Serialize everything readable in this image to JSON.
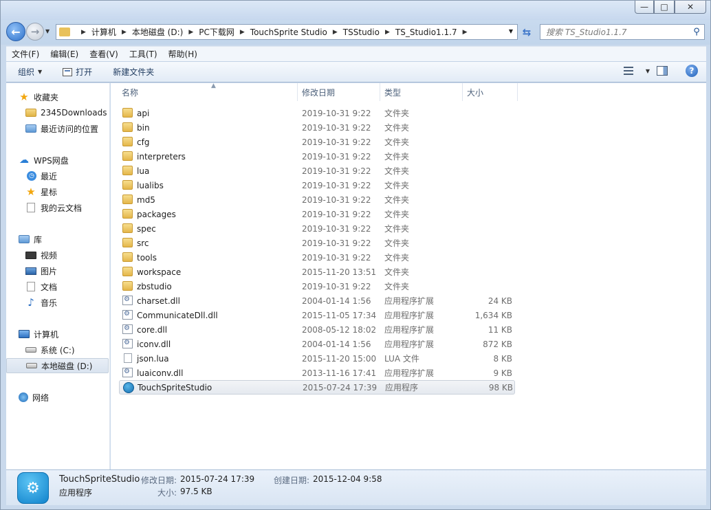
{
  "window": {
    "minimize": "—",
    "maximize": "□",
    "close": "✕"
  },
  "nav": {
    "back": "←",
    "forward": "→",
    "breadcrumbs": [
      "计算机",
      "本地磁盘 (D:)",
      "PC下载网",
      "TouchSprite Studio",
      "TSStudio",
      "TS_Studio1.1.7"
    ],
    "search_placeholder": "搜索 TS_Studio1.1.7"
  },
  "menu": [
    "文件(F)",
    "编辑(E)",
    "查看(V)",
    "工具(T)",
    "帮助(H)"
  ],
  "toolbar": {
    "organize": "组织",
    "open": "打开",
    "new_folder": "新建文件夹"
  },
  "sidebar": {
    "favorites": "收藏夹",
    "fav_items": [
      "2345Downloads",
      "最近访问的位置"
    ],
    "wps": "WPS网盘",
    "wps_items": [
      "最近",
      "星标",
      "我的云文档"
    ],
    "libraries": "库",
    "lib_items": [
      "视频",
      "图片",
      "文档",
      "音乐"
    ],
    "computer": "计算机",
    "computer_items": [
      "系统 (C:)",
      "本地磁盘 (D:)"
    ],
    "network": "网络"
  },
  "columns": {
    "name": "名称",
    "date": "修改日期",
    "type": "类型",
    "size": "大小"
  },
  "files": [
    {
      "name": "api",
      "date": "2019-10-31 9:22",
      "type": "文件夹",
      "size": "",
      "kind": "folder"
    },
    {
      "name": "bin",
      "date": "2019-10-31 9:22",
      "type": "文件夹",
      "size": "",
      "kind": "folder"
    },
    {
      "name": "cfg",
      "date": "2019-10-31 9:22",
      "type": "文件夹",
      "size": "",
      "kind": "folder"
    },
    {
      "name": "interpreters",
      "date": "2019-10-31 9:22",
      "type": "文件夹",
      "size": "",
      "kind": "folder"
    },
    {
      "name": "lua",
      "date": "2019-10-31 9:22",
      "type": "文件夹",
      "size": "",
      "kind": "folder"
    },
    {
      "name": "lualibs",
      "date": "2019-10-31 9:22",
      "type": "文件夹",
      "size": "",
      "kind": "folder"
    },
    {
      "name": "md5",
      "date": "2019-10-31 9:22",
      "type": "文件夹",
      "size": "",
      "kind": "folder"
    },
    {
      "name": "packages",
      "date": "2019-10-31 9:22",
      "type": "文件夹",
      "size": "",
      "kind": "folder"
    },
    {
      "name": "spec",
      "date": "2019-10-31 9:22",
      "type": "文件夹",
      "size": "",
      "kind": "folder"
    },
    {
      "name": "src",
      "date": "2019-10-31 9:22",
      "type": "文件夹",
      "size": "",
      "kind": "folder"
    },
    {
      "name": "tools",
      "date": "2019-10-31 9:22",
      "type": "文件夹",
      "size": "",
      "kind": "folder"
    },
    {
      "name": "workspace",
      "date": "2015-11-20 13:51",
      "type": "文件夹",
      "size": "",
      "kind": "folder"
    },
    {
      "name": "zbstudio",
      "date": "2019-10-31 9:22",
      "type": "文件夹",
      "size": "",
      "kind": "folder"
    },
    {
      "name": "charset.dll",
      "date": "2004-01-14 1:56",
      "type": "应用程序扩展",
      "size": "24 KB",
      "kind": "dll"
    },
    {
      "name": "CommunicateDll.dll",
      "date": "2015-11-05 17:34",
      "type": "应用程序扩展",
      "size": "1,634 KB",
      "kind": "dll"
    },
    {
      "name": "core.dll",
      "date": "2008-05-12 18:02",
      "type": "应用程序扩展",
      "size": "11 KB",
      "kind": "dll"
    },
    {
      "name": "iconv.dll",
      "date": "2004-01-14 1:56",
      "type": "应用程序扩展",
      "size": "872 KB",
      "kind": "dll"
    },
    {
      "name": "json.lua",
      "date": "2015-11-20 15:00",
      "type": "LUA 文件",
      "size": "8 KB",
      "kind": "file"
    },
    {
      "name": "luaiconv.dll",
      "date": "2013-11-16 17:41",
      "type": "应用程序扩展",
      "size": "9 KB",
      "kind": "dll"
    },
    {
      "name": "TouchSpriteStudio",
      "date": "2015-07-24 17:39",
      "type": "应用程序",
      "size": "98 KB",
      "kind": "app"
    }
  ],
  "details": {
    "name": "TouchSpriteStudio",
    "type": "应用程序",
    "modified_label": "修改日期:",
    "modified": "2015-07-24 17:39",
    "created_label": "创建日期:",
    "created": "2015-12-04 9:58",
    "size_label": "大小:",
    "size": "97.5 KB"
  }
}
